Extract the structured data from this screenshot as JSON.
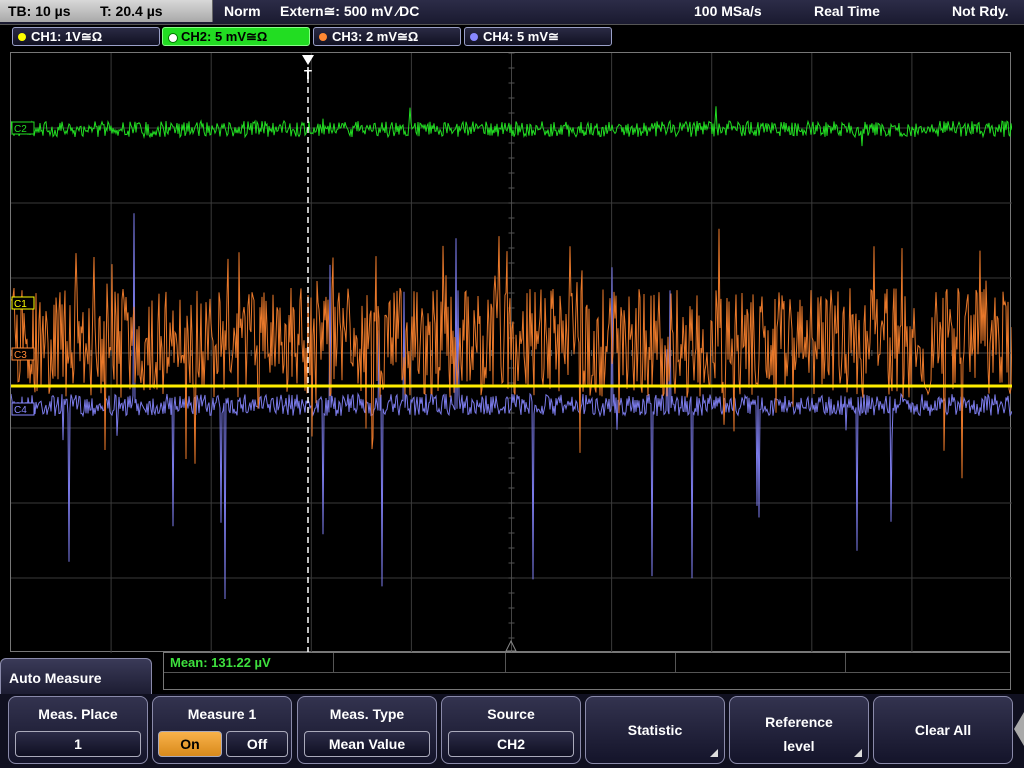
{
  "status": {
    "timebase": "TB: 10 µs",
    "trigger_time": "T: 20.4 µs",
    "mode": "Norm",
    "trigger_source": "Extern≅: 500 mV ⁄DC",
    "sample_rate": "100 MSa/s",
    "acq_mode": "Real Time",
    "state": "Not Rdy."
  },
  "channels": [
    {
      "label": "CH1: 1V≅Ω",
      "color": "#ffff00"
    },
    {
      "label": "CH2: 5 mV≅Ω",
      "color": "#22dd22"
    },
    {
      "label": "CH3: 2 mV≅Ω",
      "color": "#ff8833"
    },
    {
      "label": "CH4: 5 mV≅",
      "color": "#8888ff"
    }
  ],
  "markers": {
    "c1": "C1",
    "c2": "C2",
    "c3": "C3",
    "c4": "C4",
    "trigger": "T"
  },
  "measurement": {
    "mean": "Mean: 131.22 µV"
  },
  "menu": {
    "title": "Auto Measure",
    "meas_place": {
      "title": "Meas. Place",
      "value": "1"
    },
    "measure1": {
      "title": "Measure 1",
      "on": "On",
      "off": "Off"
    },
    "meas_type": {
      "title": "Meas. Type",
      "value": "Mean Value"
    },
    "source": {
      "title": "Source",
      "value": "CH2"
    },
    "statistic": "Statistic",
    "reference": {
      "line1": "Reference",
      "line2": "level"
    },
    "clear_all": "Clear All"
  }
}
